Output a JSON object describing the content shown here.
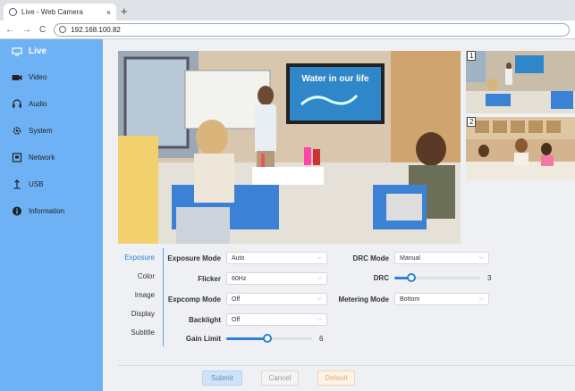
{
  "browser": {
    "tab_title": "Live - Web Camera",
    "tab_close": "×",
    "new_tab": "+",
    "nav_back": "←",
    "nav_forward": "→",
    "nav_reload": "C",
    "address": "192.168.100.82"
  },
  "sidebar": {
    "items": [
      {
        "label": "Live",
        "icon": "monitor-icon"
      },
      {
        "label": "Video",
        "icon": "camera-icon"
      },
      {
        "label": "Audio",
        "icon": "headphones-icon"
      },
      {
        "label": "System",
        "icon": "gear-icon"
      },
      {
        "label": "Network",
        "icon": "network-icon"
      },
      {
        "label": "USB",
        "icon": "usb-icon"
      },
      {
        "label": "Information",
        "icon": "info-icon"
      }
    ]
  },
  "video": {
    "board_text": "Water in our life",
    "thumb1_num": "1",
    "thumb2_num": "2"
  },
  "settings": {
    "tabs": [
      "Exposure",
      "Color",
      "Image",
      "Display",
      "Subtitle"
    ],
    "exposure_mode": {
      "label": "Exposure Mode",
      "value": "Auto"
    },
    "flicker": {
      "label": "Flicker",
      "value": "60Hz"
    },
    "expcomp_mode": {
      "label": "Expcomp Mode",
      "value": "Off"
    },
    "backlight": {
      "label": "Backlight",
      "value": "Off"
    },
    "gain_limit": {
      "label": "Gain Limit",
      "value": "6",
      "fraction": 0.48
    },
    "drc_mode": {
      "label": "DRC Mode",
      "value": "Manual"
    },
    "drc": {
      "label": "DRC",
      "value": "3",
      "fraction": 0.2
    },
    "metering_mode": {
      "label": "Metering Mode",
      "value": "Bottom"
    }
  },
  "buttons": {
    "submit": "Submit",
    "cancel": "Cancel",
    "default": "Default"
  },
  "colors": {
    "sidebar": "#6eb2f5",
    "accent": "#2d7fd8"
  }
}
